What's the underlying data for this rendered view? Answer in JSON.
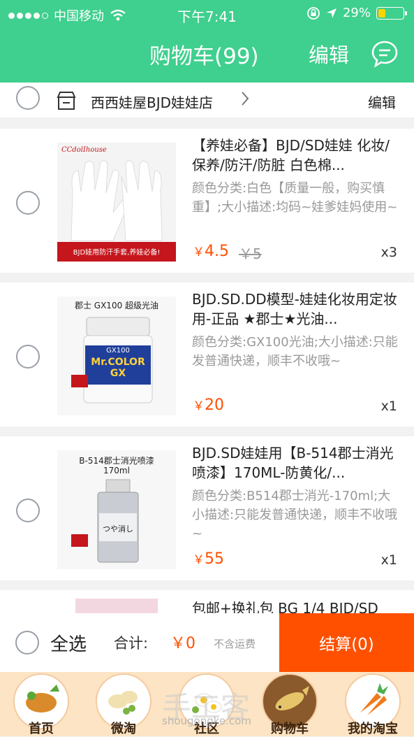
{
  "status_bar": {
    "carrier": "中国移动",
    "time": "下午7:41",
    "battery": "29%",
    "battery_level": 0.29
  },
  "nav": {
    "title": "购物车(99)",
    "edit": "编辑",
    "message_icon": "chat-bubble-icon"
  },
  "shop": {
    "name": "西西娃屋BJD娃娃店",
    "edit": "编辑"
  },
  "items": [
    {
      "title": "【养娃必备】BJD/SD娃娃 化妆/保养/防汗/防脏 白色棉...",
      "sku": "颜色分类:白色【质量一般，购买慎重】;大小描述:均码~娃爹娃妈使用~",
      "price": "4.5",
      "currency": "￥",
      "original_price": "￥5",
      "qty": "x3",
      "thumb": {
        "brand": "CCdolIhouse",
        "banner": "BJD娃用防汗手套,养娃必备!"
      }
    },
    {
      "title": "BJD.SD.DD模型-娃娃化妆用定妆用-正品 ★郡士★光油...",
      "sku": "颜色分类:GX100光油;大小描述:只能发普通快递，顺丰不收哦~",
      "price": "20",
      "currency": "￥",
      "qty": "x1",
      "thumb": {
        "caption": "郡士 GX100 超级光油",
        "label": "Mr.COLOR GX",
        "code": "GX100"
      }
    },
    {
      "title": "BJD.SD娃娃用【B-514郡士消光喷漆】170ML-防黄化/...",
      "sku": "颜色分类:B514郡士消光-170ml;大小描述:只能发普通快递，顺丰不收哦~",
      "price": "55",
      "currency": "￥",
      "qty": "x1",
      "thumb": {
        "caption": "B-514郡士消光喷漆",
        "volume": "170ml",
        "label": "つや消し"
      }
    },
    {
      "title": "包邮+换礼包 BG 1/4 BJD/SD"
    }
  ],
  "footer": {
    "select_all": "全选",
    "total_label": "合计:",
    "total_value": "￥0",
    "shipping_note": "不含运费",
    "checkout": "结算(0)"
  },
  "tabbar": [
    {
      "label": "首页",
      "icon": "roast-chicken-icon"
    },
    {
      "label": "微淘",
      "icon": "dumplings-icon"
    },
    {
      "label": "社区",
      "icon": "eggs-icon"
    },
    {
      "label": "购物车",
      "icon": "fish-icon"
    },
    {
      "label": "我的淘宝",
      "icon": "carrots-icon"
    }
  ],
  "watermark": {
    "main": "手工客",
    "sub": "shougongke.com"
  },
  "colors": {
    "header": "#3fcf8e",
    "accent": "#ff5000"
  }
}
